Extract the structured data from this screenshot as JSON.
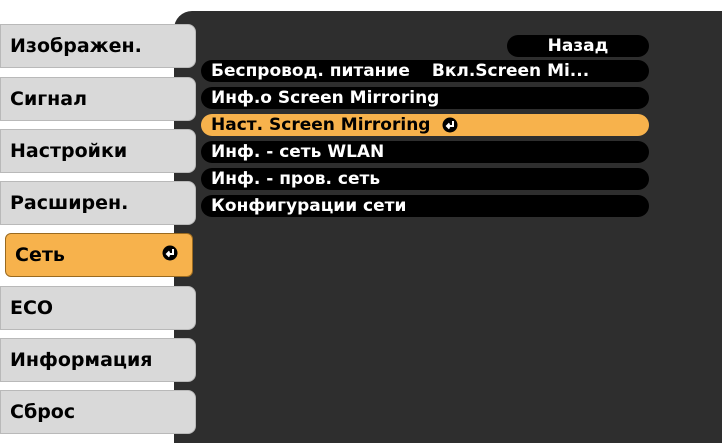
{
  "menu": {
    "items": [
      {
        "label": "Изображен."
      },
      {
        "label": "Сигнал"
      },
      {
        "label": "Настройки"
      },
      {
        "label": "Расширен."
      },
      {
        "label": "Сеть",
        "selected": true,
        "icon": "enter-icon"
      },
      {
        "label": "ECO"
      },
      {
        "label": "Информация"
      },
      {
        "label": "Сброс"
      }
    ]
  },
  "panel": {
    "back_label": "Назад",
    "rows": [
      {
        "label": "Беспровод. питание",
        "value": "Вкл.Screen Mi..."
      },
      {
        "label": "Инф.о Screen Mirroring"
      },
      {
        "label": "Наст. Screen Mirroring",
        "selected": true,
        "icon": "enter-icon"
      },
      {
        "label": "Инф. - сеть WLAN"
      },
      {
        "label": "Инф. - пров. сеть"
      },
      {
        "label": "Конфигурации сети"
      }
    ]
  },
  "colors": {
    "highlight": "#f7b24c",
    "panel_bg": "#2e2e2e",
    "menu_bg": "#d9d9d9",
    "row_bg": "#000000"
  }
}
